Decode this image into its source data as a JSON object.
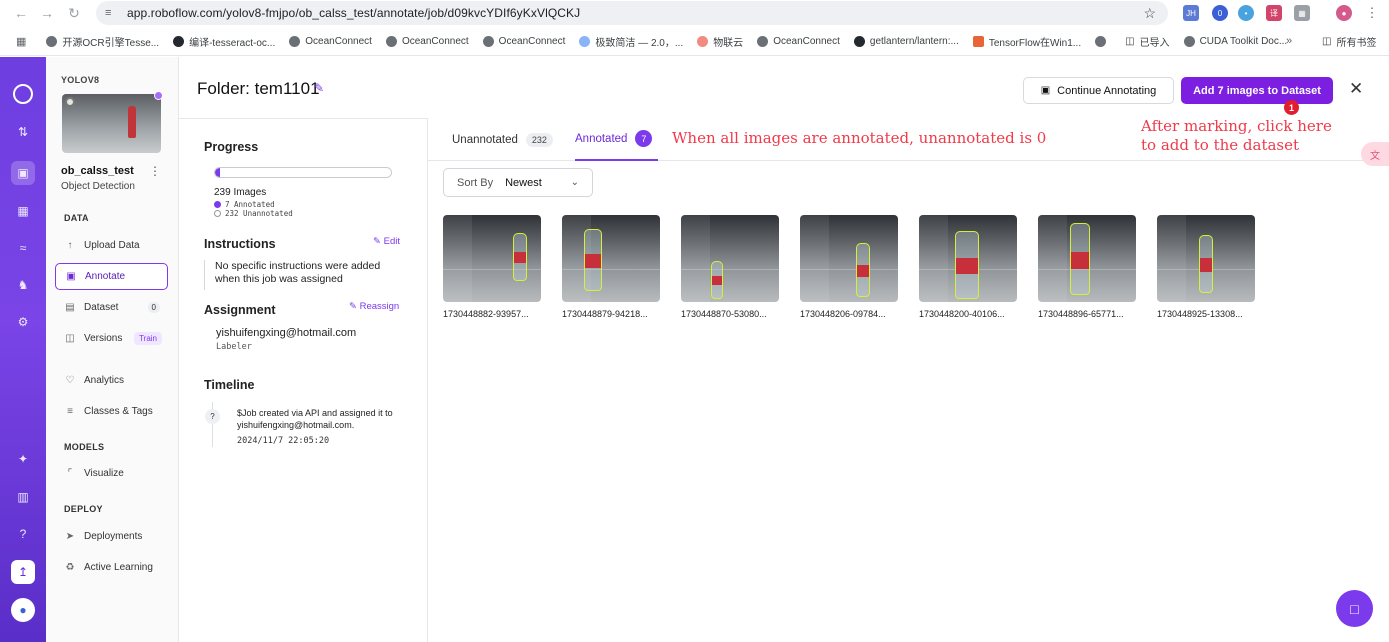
{
  "browser": {
    "url": "app.roboflow.com/yolov8-fmjpo/ob_calss_test/annotate/job/d09kvcYDIf6yKxVlQCKJ",
    "ext_badge": "0",
    "bookmarks": [
      "开源OCR引擎Tesse...",
      "编译-tesseract-oc...",
      "OceanConnect",
      "OceanConnect",
      "OceanConnect",
      "极致简洁 — 2.0，...",
      "物联云",
      "OceanConnect",
      "getlantern/lantern:...",
      "TensorFlow在Win1...",
      "已导入",
      "CUDA Toolkit Doc..."
    ],
    "all_bookmarks": "所有书签"
  },
  "sidebar": {
    "workspace": "YOLOV8",
    "project_name": "ob_calss_test",
    "project_type": "Object Detection",
    "sections": {
      "data": "DATA",
      "models": "MODELS",
      "deploy": "DEPLOY"
    },
    "items": {
      "upload": "Upload Data",
      "annotate": "Annotate",
      "dataset": "Dataset",
      "dataset_count": "0",
      "versions": "Versions",
      "versions_badge": "Train",
      "analytics": "Analytics",
      "classes": "Classes & Tags",
      "visualize": "Visualize",
      "deployments": "Deployments",
      "active_learning": "Active Learning"
    }
  },
  "header": {
    "folder_title": "Folder: tem1101",
    "continue_label": "Continue Annotating",
    "add_label": "Add 7 images to Dataset",
    "step_badge": "1"
  },
  "job": {
    "progress_title": "Progress",
    "progress_fraction": 0.0293,
    "images_total": "239 Images",
    "annotated_legend": "7 Annotated",
    "unannotated_legend": "232 Unannotated",
    "instructions_title": "Instructions",
    "edit_label": "Edit",
    "instructions_text": "No specific instructions were added when this job was assigned",
    "assignment_title": "Assignment",
    "reassign_label": "Reassign",
    "assignee": "yishuifengxing@hotmail.com",
    "role": "Labeler",
    "timeline_title": "Timeline",
    "timeline_icon": "?",
    "timeline_text": "$Job created via API and assigned it to yishuifengxing@hotmail.com.",
    "timeline_time": "2024/11/7 22:05:20"
  },
  "tabs": {
    "unannotated": "Unannotated",
    "unannotated_count": "232",
    "annotated": "Annotated",
    "annotated_count": "7"
  },
  "notes": {
    "tab_note": "When all images are annotated, unannotated is 0",
    "button_note_1": "After marking, click here",
    "button_note_2": "to add to the dataset"
  },
  "sort": {
    "label": "Sort By",
    "value": "Newest"
  },
  "images": [
    {
      "name": "1730448882-93957..."
    },
    {
      "name": "1730448879-94218..."
    },
    {
      "name": "1730448870-53080..."
    },
    {
      "name": "1730448206-09784..."
    },
    {
      "name": "1730448200-40106..."
    },
    {
      "name": "1730448896-65771..."
    },
    {
      "name": "1730448925-13308..."
    }
  ],
  "colors": {
    "accent": "#7c3aed",
    "annotation": "#d4f03a",
    "note": "#f03a4a"
  }
}
